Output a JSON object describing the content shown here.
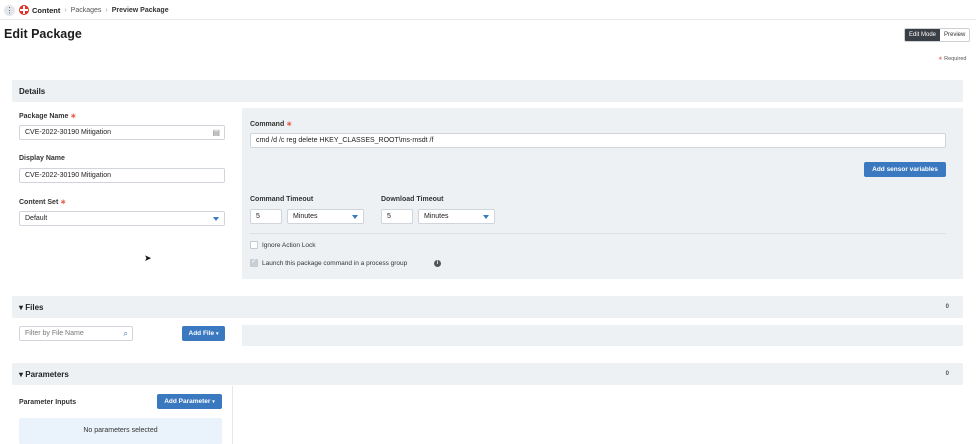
{
  "breadcrumb": {
    "root": "Content",
    "items": [
      "Packages",
      "Preview Package"
    ]
  },
  "page": {
    "title": "Edit Package",
    "modes": [
      "Edit Mode",
      "Preview"
    ],
    "required_note": "Required"
  },
  "details": {
    "section_title": "Details",
    "package_name": {
      "label": "Package Name",
      "value": "CVE-2022-30190 Mitigation"
    },
    "display_name": {
      "label": "Display Name",
      "value": "CVE-2022-30190 Mitigation"
    },
    "content_set": {
      "label": "Content Set",
      "value": "Default"
    },
    "command": {
      "label": "Command",
      "value": "cmd /d /c reg delete HKEY_CLASSES_ROOT\\ms-msdt /f"
    },
    "add_sensor_variables": "Add sensor variables",
    "command_timeout": {
      "label": "Command Timeout",
      "value": "5",
      "unit": "Minutes"
    },
    "download_timeout": {
      "label": "Download Timeout",
      "value": "5",
      "unit": "Minutes"
    },
    "ignore_action_lock": {
      "label": "Ignore Action Lock",
      "checked": false
    },
    "launch_process_group": {
      "label": "Launch this package command in a process group",
      "checked": true
    }
  },
  "files": {
    "section_title": "Files",
    "count": "0",
    "filter_placeholder": "Filter by File Name",
    "add_file": "Add File"
  },
  "parameters": {
    "section_title": "Parameters",
    "count": "0",
    "inputs_label": "Parameter Inputs",
    "add_parameter": "Add Parameter",
    "empty_text": "No parameters selected"
  },
  "colors": {
    "accent": "#3a78c0",
    "required": "#e55b4a",
    "brand": "#e2302a"
  }
}
